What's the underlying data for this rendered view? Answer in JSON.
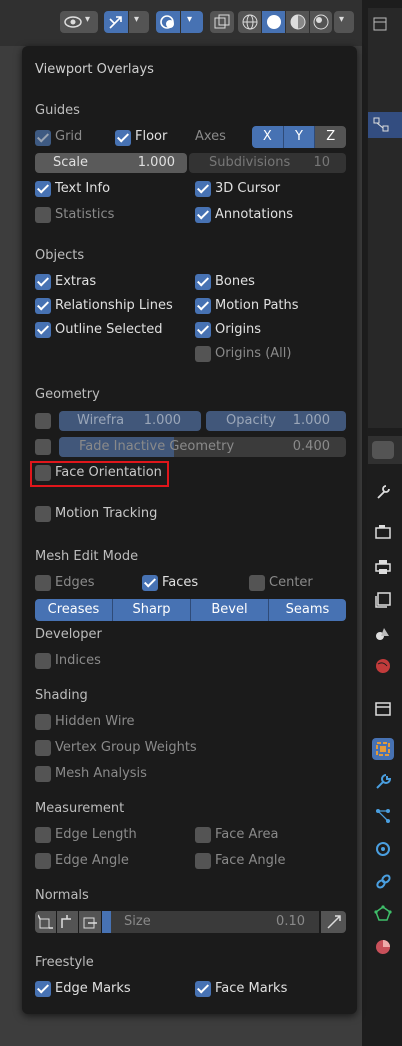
{
  "popup": {
    "title": "Viewport Overlays",
    "guides": {
      "heading": "Guides",
      "grid_label": "Grid",
      "floor_label": "Floor",
      "axes_label": "Axes",
      "axis_x": "X",
      "axis_y": "Y",
      "axis_z": "Z",
      "scale_label": "Scale",
      "scale_value": "1.000",
      "subdivisions_label": "Subdivisions",
      "subdivisions_value": "10",
      "text_info": "Text Info",
      "cursor_3d": "3D Cursor",
      "statistics": "Statistics",
      "annotations": "Annotations"
    },
    "objects": {
      "heading": "Objects",
      "extras": "Extras",
      "bones": "Bones",
      "relationship_lines": "Relationship Lines",
      "motion_paths": "Motion Paths",
      "outline_selected": "Outline Selected",
      "origins": "Origins",
      "origins_all": "Origins (All)"
    },
    "geometry": {
      "heading": "Geometry",
      "wireframe_label": "Wirefra",
      "wireframe_value": "1.000",
      "opacity_label": "Opacity",
      "opacity_value": "1.000",
      "fade_label": "Fade Inactive Geometry",
      "fade_value": "0.400",
      "face_orientation": "Face Orientation"
    },
    "motion_tracking": "Motion Tracking",
    "mesh_edit": {
      "heading": "Mesh Edit Mode",
      "edges": "Edges",
      "faces": "Faces",
      "center": "Center",
      "creases": "Creases",
      "sharp": "Sharp",
      "bevel": "Bevel",
      "seams": "Seams"
    },
    "developer": {
      "heading": "Developer",
      "indices": "Indices"
    },
    "shading": {
      "heading": "Shading",
      "hidden_wire": "Hidden Wire",
      "vertex_group_weights": "Vertex Group Weights",
      "mesh_analysis": "Mesh Analysis"
    },
    "measurement": {
      "heading": "Measurement",
      "edge_length": "Edge Length",
      "face_area": "Face Area",
      "edge_angle": "Edge Angle",
      "face_angle": "Face Angle"
    },
    "normals": {
      "heading": "Normals",
      "size_label": "Size",
      "size_value": "0.10"
    },
    "freestyle": {
      "heading": "Freestyle",
      "edge_marks": "Edge Marks",
      "face_marks": "Face Marks"
    }
  },
  "colors": {
    "accent": "#4772b3",
    "highlight": "#e0161b",
    "popup_bg": "#1b1b1b"
  },
  "icons": [
    "eye-icon",
    "gizmo-icon",
    "overlay-icon",
    "xray-icon",
    "wireframe-shading-icon",
    "solid-shading-icon",
    "material-shading-icon",
    "rendered-shading-icon",
    "tool-icon",
    "render-icon",
    "output-icon",
    "view-layer-icon",
    "scene-icon",
    "world-icon",
    "collection-icon",
    "object-icon",
    "modifier-icon",
    "particles-icon",
    "physics-icon",
    "constraints-icon",
    "data-icon",
    "material-icon"
  ]
}
